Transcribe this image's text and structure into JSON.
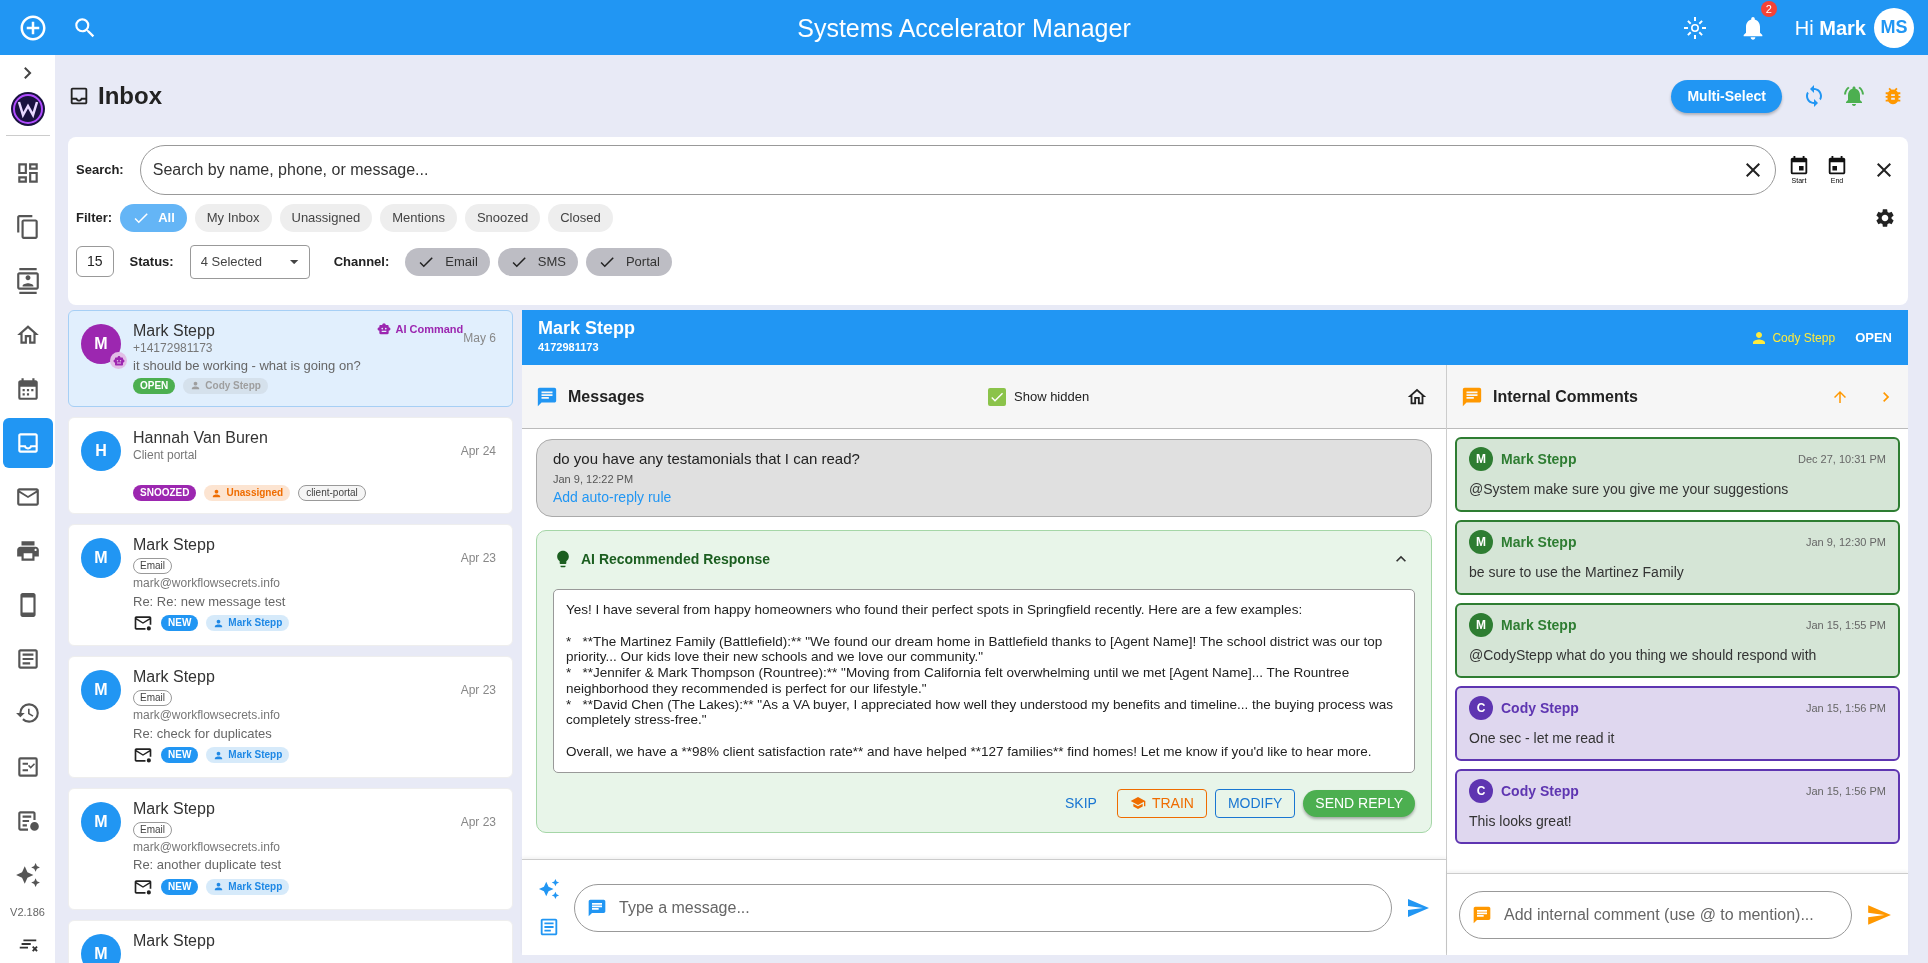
{
  "app_bar": {
    "title": "Systems Accelerator Manager",
    "notification_count": "2",
    "greeting": "Hi",
    "user_name": "Mark",
    "avatar_initials": "MS"
  },
  "sidebar": {
    "items": [
      {
        "kind": "dashboard",
        "selected": false
      },
      {
        "kind": "copy",
        "selected": false
      },
      {
        "kind": "contact",
        "selected": false
      },
      {
        "kind": "home",
        "selected": false
      },
      {
        "kind": "calendar",
        "selected": false
      },
      {
        "kind": "inbox",
        "selected": true
      },
      {
        "kind": "mail",
        "selected": false
      },
      {
        "kind": "print",
        "selected": false
      },
      {
        "kind": "phone",
        "selected": false
      },
      {
        "kind": "article",
        "selected": false
      },
      {
        "kind": "history",
        "selected": false
      },
      {
        "kind": "checklist",
        "selected": false
      },
      {
        "kind": "schedule",
        "selected": false
      },
      {
        "kind": "sparkle",
        "selected": false
      }
    ],
    "version": "V2.186"
  },
  "page": {
    "title": "Inbox",
    "multi_select": "Multi-Select"
  },
  "filters": {
    "search_label": "Search:",
    "search_placeholder": "Search by name, phone, or message...",
    "date_buttons": [
      {
        "label": "Start"
      },
      {
        "label": "End"
      }
    ],
    "filter_label": "Filter:",
    "chips": [
      {
        "label": "All",
        "selected": true
      },
      {
        "label": "My Inbox",
        "selected": false
      },
      {
        "label": "Unassigned",
        "selected": false
      },
      {
        "label": "Mentions",
        "selected": false
      },
      {
        "label": "Snoozed",
        "selected": false
      },
      {
        "label": "Closed",
        "selected": false
      }
    ],
    "count": "15",
    "status_label": "Status:",
    "status_value": "4 Selected",
    "channel_label": "Channel:",
    "channels": [
      {
        "label": "Email",
        "checked": true
      },
      {
        "label": "SMS",
        "checked": true
      },
      {
        "label": "Portal",
        "checked": true
      }
    ]
  },
  "conversations": [
    {
      "selected": true,
      "initial": "M",
      "color": "#9c27b0",
      "bot": true,
      "name": "Mark Stepp",
      "ai_command": "AI Command",
      "date": "May 6",
      "subtitle": "+14172981173",
      "preview": "it should be working - what is going on?",
      "badges": [
        {
          "kind": "status",
          "label": "OPEN",
          "color": "#4caf50"
        },
        {
          "kind": "person",
          "label": "Cody Stepp",
          "color": "#9e9e9e"
        }
      ]
    },
    {
      "selected": false,
      "initial": "H",
      "color": "#2196f3",
      "bot": false,
      "name": "Hannah Van Buren",
      "date": "Apr 24",
      "subtitle": "Client portal",
      "badges": [
        {
          "kind": "status",
          "label": "SNOOZED",
          "color": "#9c27b0"
        },
        {
          "kind": "person",
          "label": "Unassigned",
          "color": "#ef6c00"
        },
        {
          "kind": "tag",
          "label": "client-portal"
        }
      ]
    },
    {
      "selected": false,
      "initial": "M",
      "color": "#2196f3",
      "bot": false,
      "name": "Mark Stepp",
      "channel_tag": "Email",
      "date": "Apr 23",
      "subtitle": "mark@workflowsecrets.info",
      "preview": "Re: Re: new message test",
      "badges": [
        {
          "kind": "mail"
        },
        {
          "kind": "status",
          "label": "NEW",
          "color": "#2196f3"
        },
        {
          "kind": "person",
          "label": "Mark Stepp",
          "color": "#1e88e5"
        }
      ]
    },
    {
      "selected": false,
      "initial": "M",
      "color": "#2196f3",
      "bot": false,
      "name": "Mark Stepp",
      "channel_tag": "Email",
      "date": "Apr 23",
      "subtitle": "mark@workflowsecrets.info",
      "preview": "Re: check for duplicates",
      "badges": [
        {
          "kind": "mail"
        },
        {
          "kind": "status",
          "label": "NEW",
          "color": "#2196f3"
        },
        {
          "kind": "person",
          "label": "Mark Stepp",
          "color": "#1e88e5"
        }
      ]
    },
    {
      "selected": false,
      "initial": "M",
      "color": "#2196f3",
      "bot": false,
      "name": "Mark Stepp",
      "channel_tag": "Email",
      "date": "Apr 23",
      "subtitle": "mark@workflowsecrets.info",
      "preview": "Re: another duplicate test",
      "badges": [
        {
          "kind": "mail"
        },
        {
          "kind": "status",
          "label": "NEW",
          "color": "#2196f3"
        },
        {
          "kind": "person",
          "label": "Mark Stepp",
          "color": "#1e88e5"
        }
      ]
    },
    {
      "selected": false,
      "initial": "M",
      "color": "#2196f3",
      "bot": false,
      "name": "Mark Stepp"
    }
  ],
  "detail": {
    "name": "Mark Stepp",
    "phone": "4172981173",
    "assignee": "Cody Stepp",
    "status": "OPEN",
    "messages": {
      "title": "Messages",
      "show_hidden": {
        "label": "Show hidden",
        "checked": true
      },
      "items": [
        {
          "text": "do you have any testamonials that I can read?",
          "time": "Jan 9, 12:22 PM",
          "link": "Add auto-reply rule"
        }
      ],
      "ai_response": {
        "title": "AI Recommended Response",
        "expanded": true,
        "text": "Yes! I have several from happy homeowners who found their perfect spots in Springfield recently. Here are a few examples:\n\n*   **The Martinez Family (Battlefield):** \"We found our dream home in Battlefield thanks to [Agent Name]! The school district was our top priority... Our kids love their new schools and we love our community.\"\n*   **Jennifer & Mark Thompson (Rountree):** \"Moving from California felt overwhelming until we met [Agent Name]... The Rountree neighborhood they recommended is perfect for our lifestyle.\"\n*   **David Chen (The Lakes):** \"As a VA buyer, I appreciated how well they understood my benefits and timeline... the buying process was completely stress-free.\"\n\nOverall, we have a **98% client satisfaction rate** and have helped **127 families** find homes! Let me know if you'd like to hear more.",
        "buttons": [
          {
            "kind": "text",
            "label": "SKIP",
            "color": "#1976d2"
          },
          {
            "kind": "outlined-icon",
            "label": "TRAIN",
            "color": "#ef6c00"
          },
          {
            "kind": "outlined",
            "label": "MODIFY",
            "color": "#1976d2"
          },
          {
            "kind": "filled",
            "label": "SEND REPLY",
            "color": "#4caf50"
          }
        ]
      },
      "composer_placeholder": "Type a message..."
    },
    "comments": {
      "title": "Internal Comments",
      "items": [
        {
          "initial": "M",
          "author": "Mark Stepp",
          "time": "Dec 27, 10:31 PM",
          "text": "@System make sure you give me your suggestions",
          "color": "#2e7d32"
        },
        {
          "initial": "M",
          "author": "Mark Stepp",
          "time": "Jan 9, 12:30 PM",
          "text": "be sure to use the Martinez Family",
          "color": "#2e7d32"
        },
        {
          "initial": "M",
          "author": "Mark Stepp",
          "time": "Jan 15, 1:55 PM",
          "text": "@CodyStepp what do you thing we should respond with",
          "color": "#2e7d32"
        },
        {
          "initial": "C",
          "author": "Cody Stepp",
          "time": "Jan 15, 1:56 PM",
          "text": "One sec - let me read it",
          "color": "#5e35b1"
        },
        {
          "initial": "C",
          "author": "Cody Stepp",
          "time": "Jan 15, 1:56 PM",
          "text": "This looks great!",
          "color": "#5e35b1"
        }
      ],
      "composer_placeholder": "Add internal comment (use @ to mention)..."
    }
  }
}
